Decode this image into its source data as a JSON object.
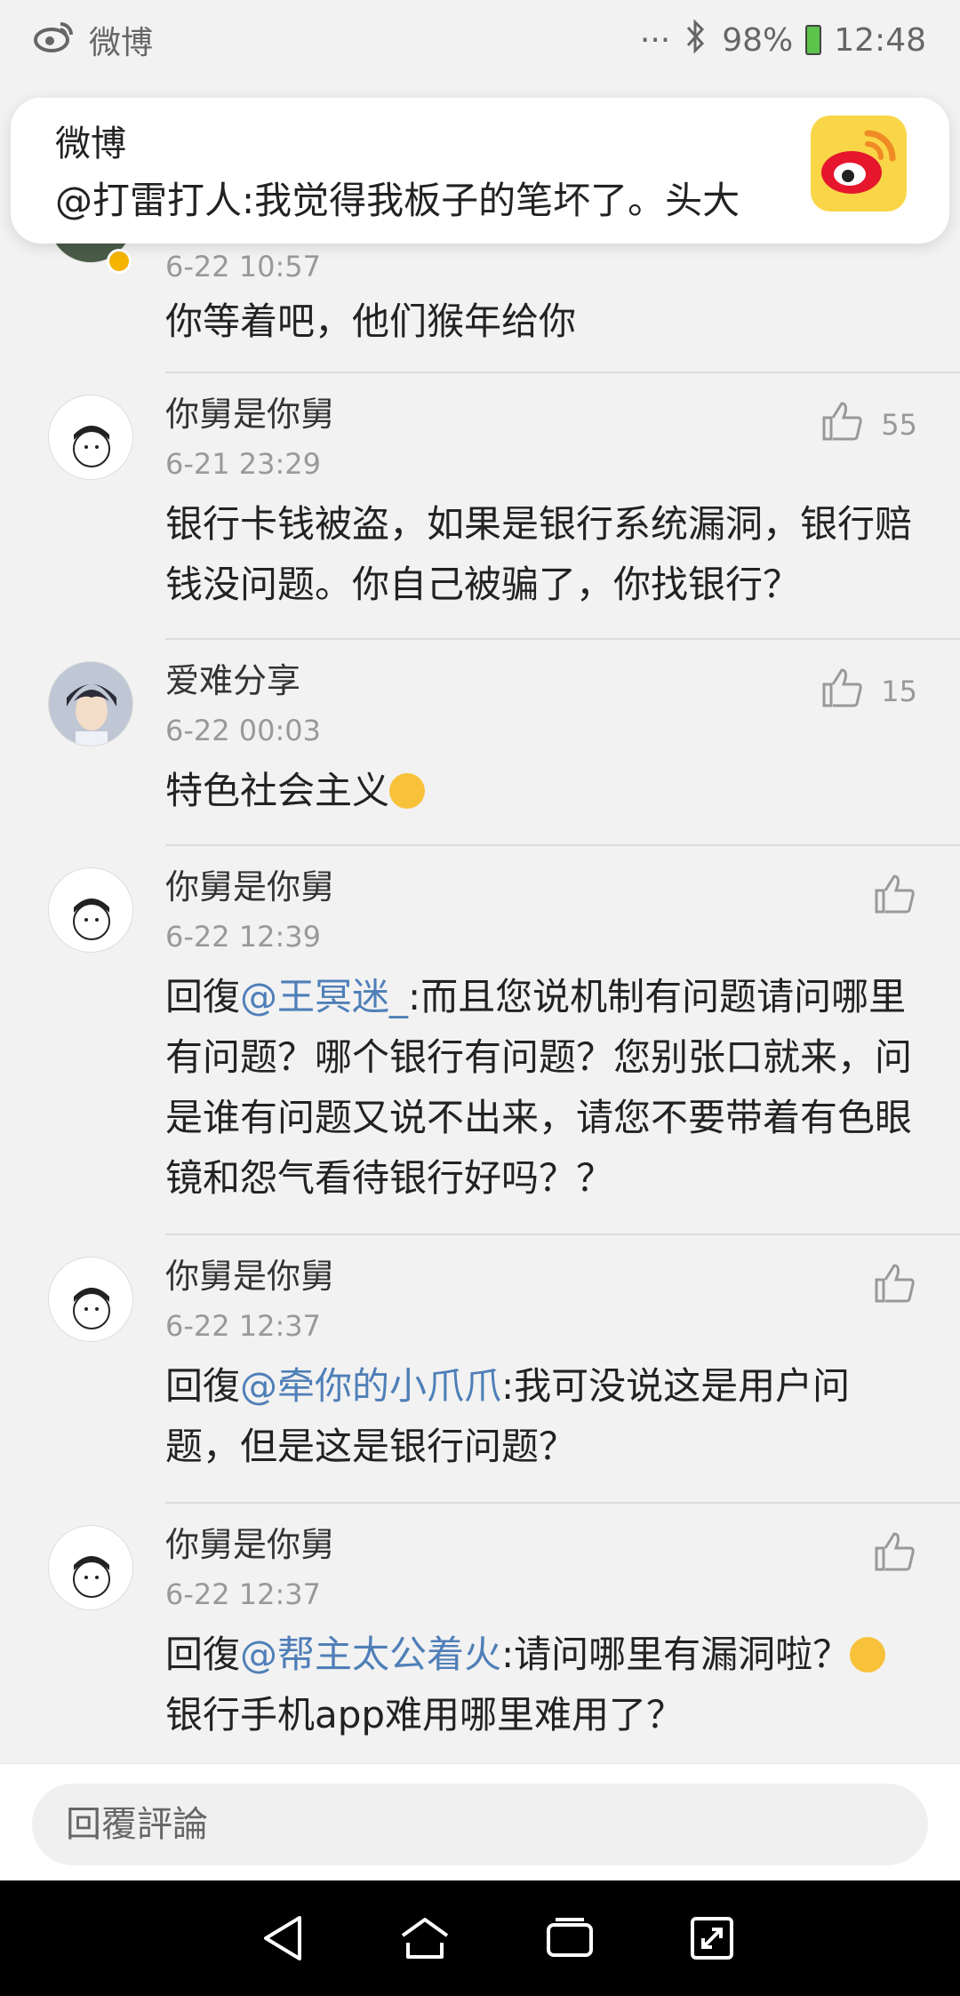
{
  "status_bar": {
    "app_name": "微博",
    "dots": "···",
    "battery": "98%",
    "time": "12:48"
  },
  "notification": {
    "title": "微博",
    "body": "@打雷打人:我觉得我板子的笔坏了。头大"
  },
  "comments": [
    {
      "name": "",
      "time": "6-22 10:57",
      "text": "你等着吧，他们猴年给你",
      "likes": ""
    },
    {
      "name": "你舅是你舅",
      "time": "6-21 23:29",
      "text": "银行卡钱被盗，如果是银行系统漏洞，银行赔钱没问题。你自己被骗了，你找银行？",
      "likes": "55"
    },
    {
      "name": "爱难分享",
      "time": "6-22 00:03",
      "text": "特色社会主义",
      "likes": "15"
    },
    {
      "name": "你舅是你舅",
      "time": "6-22 12:39",
      "reply_prefix": "回復",
      "mention": "@王冥迷_",
      "text": ":而且您说机制有问题请问哪里有问题？哪个银行有问题？您别张口就来，问是谁有问题又说不出来，请您不要带着有色眼镜和怨气看待银行好吗？？",
      "likes": ""
    },
    {
      "name": "你舅是你舅",
      "time": "6-22 12:37",
      "reply_prefix": "回復",
      "mention": "@牵你的小爪爪",
      "text": ":我可没说这是用户问题，但是这是银行问题？",
      "likes": ""
    },
    {
      "name": "你舅是你舅",
      "time": "6-22 12:37",
      "reply_prefix": "回復",
      "mention": "@帮主太公着火",
      "text": ":请问哪里有漏洞啦？",
      "text2": "银行手机app难用哪里难用了？",
      "likes": ""
    }
  ],
  "reply_input": {
    "placeholder": "回覆評論"
  },
  "colors": {
    "mention": "#4f7fb8",
    "notification_icon_bg": "#f9d648",
    "weibo_red": "#e6162d"
  },
  "icons": [
    "weibo-logo-icon",
    "bluetooth-icon",
    "battery-icon",
    "thumbs-up-icon",
    "back-icon",
    "home-icon",
    "recents-icon",
    "rotate-icon"
  ]
}
